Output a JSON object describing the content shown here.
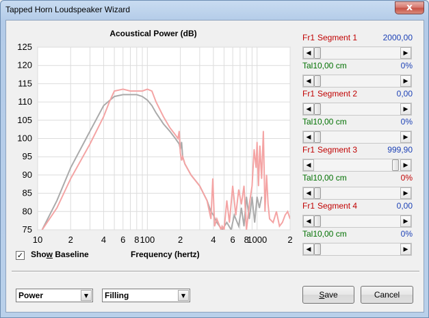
{
  "window": {
    "title": "Tapped Horn Loudspeaker Wizard",
    "close_label": "x"
  },
  "chart": {
    "title": "Acoustical Power (dB)",
    "y_ticks": [
      "125",
      "120",
      "115",
      "110",
      "105",
      "100",
      "95",
      "90",
      "85",
      "80",
      "75"
    ],
    "x_ticks": [
      "10",
      "2",
      "4",
      "6",
      "8",
      "100",
      "2",
      "4",
      "6",
      "8",
      "1000",
      "2"
    ],
    "xlabel": "Frequency (hertz)"
  },
  "chart_data": {
    "type": "line",
    "title": "Acoustical Power (dB)",
    "xlabel": "Frequency (hertz)",
    "ylabel": "",
    "x_scale": "log",
    "xlim": [
      10,
      2000
    ],
    "ylim": [
      75,
      125
    ],
    "grid": true,
    "series": [
      {
        "color": "#f4a4a4",
        "x": [
          11,
          15,
          20,
          30,
          40,
          45,
          50,
          60,
          70,
          80,
          90,
          100,
          110,
          120,
          140,
          160,
          180,
          190,
          195,
          200,
          205,
          210,
          220,
          250,
          300,
          350,
          380,
          395,
          410,
          430,
          470,
          480,
          500,
          530,
          560,
          600,
          640,
          680,
          720,
          760,
          800,
          860,
          900,
          940,
          980,
          1000,
          1030,
          1060,
          1100,
          1140,
          1180,
          1220,
          1260,
          1300,
          1400,
          1500,
          1600,
          1700,
          1800,
          1900,
          2000
        ],
        "y": [
          75,
          81,
          89,
          98.5,
          106,
          110,
          113,
          113.5,
          113,
          113,
          113,
          113.5,
          113,
          110,
          106,
          103,
          101,
          100,
          102,
          96,
          94,
          95,
          93,
          90,
          87,
          83,
          78,
          89,
          76,
          78,
          75,
          76,
          75,
          83,
          77,
          87,
          79,
          86,
          82,
          87,
          75,
          83,
          87,
          97,
          92,
          99,
          87,
          98,
          89,
          102,
          80,
          90,
          82,
          78,
          77,
          80,
          76,
          77,
          79,
          80,
          78
        ]
      },
      {
        "color": "#aaaaaa",
        "x": [
          11,
          15,
          20,
          30,
          40,
          50,
          60,
          70,
          80,
          90,
          100,
          110,
          120,
          140,
          160,
          180,
          195,
          200,
          205,
          210,
          220,
          250,
          300,
          350,
          380,
          400,
          430,
          480,
          530,
          580,
          620,
          680,
          720,
          760,
          800,
          850,
          900,
          950,
          1000,
          1050,
          1100
        ],
        "y": [
          75,
          83,
          92,
          102,
          109,
          111.5,
          112,
          112,
          112,
          111.5,
          110.5,
          109,
          107,
          104,
          102,
          100,
          98.5,
          97,
          99,
          95,
          93,
          90,
          87,
          83,
          80,
          79,
          77,
          75,
          77,
          75,
          79,
          76,
          81,
          76,
          84,
          78,
          84,
          77,
          84,
          81,
          84
        ]
      }
    ]
  },
  "segments": [
    {
      "row1_tag": "Fr1",
      "row1_name": "Segment 1",
      "row1_value": "2000,00",
      "row2_tag": "Tal1",
      "row2_text": "0,00 cm",
      "row2_value": "0%",
      "slider1": 0.0,
      "slider2": 0.0,
      "highlight": false
    },
    {
      "row1_tag": "Fr1",
      "row1_name": "Segment 2",
      "row1_value": "0,00",
      "row2_tag": "Tal1",
      "row2_text": "0,00 cm",
      "row2_value": "0%",
      "slider1": 0.0,
      "slider2": 0.0,
      "highlight": false
    },
    {
      "row1_tag": "Fr1",
      "row1_name": "Segment 3",
      "row1_value": "999,90",
      "row2_tag": "Tal1",
      "row2_text": "0,00 cm",
      "row2_value": "0%",
      "slider1": 0.98,
      "slider2": 0.0,
      "highlight": true
    },
    {
      "row1_tag": "Fr1",
      "row1_name": "Segment 4",
      "row1_value": "0,00",
      "row2_tag": "Tal1",
      "row2_text": "0,00 cm",
      "row2_value": "0%",
      "slider1": 0.0,
      "slider2": 0.0,
      "highlight": false
    }
  ],
  "show_baseline": {
    "label_pre": "Sho",
    "label_u": "w",
    "label_post": " Baseline",
    "checked": true,
    "check_glyph": "✓"
  },
  "combos": {
    "view_value": "Power",
    "fill_value": "Filling",
    "arrow": "▼"
  },
  "buttons": {
    "save_u": "S",
    "save_rest": "ave",
    "cancel": "Cancel"
  },
  "arrows": {
    "left": "◀",
    "right": "▶"
  },
  "colors": {
    "pink_series": "#f4a4a4",
    "gray_series": "#aaaaaa",
    "red_text": "#c00000",
    "green_text": "#007000",
    "blue_text": "#1a3fb5"
  }
}
